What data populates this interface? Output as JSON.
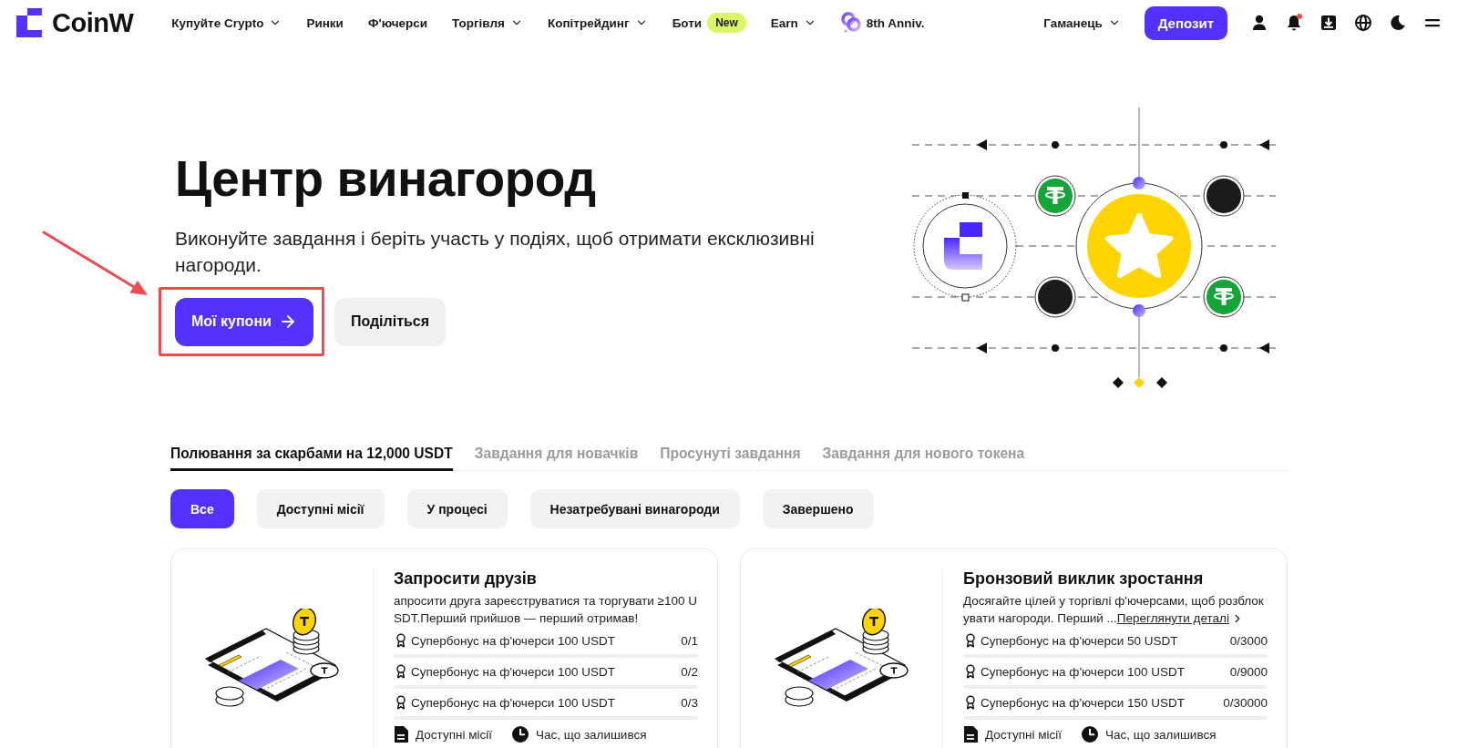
{
  "nav": {
    "logo": "CoinW",
    "items": [
      {
        "label": "Купуйте Crypto",
        "kind": "dropdown"
      },
      {
        "label": "Ринки",
        "kind": "link"
      },
      {
        "label": "Ф'ючерси",
        "kind": "link"
      },
      {
        "label": "Торгівля",
        "kind": "dropdown"
      },
      {
        "label": "Копітрейдинг",
        "kind": "dropdown"
      },
      {
        "label": "Боти",
        "kind": "badge",
        "badge": "New"
      },
      {
        "label": "Earn",
        "kind": "dropdown"
      },
      {
        "label": "8th Anniv.",
        "kind": "event"
      }
    ],
    "wallet": {
      "label": "Гаманець",
      "kind": "dropdown"
    },
    "deposit": "Депозит",
    "unread_notifications": true
  },
  "hero": {
    "title": "Центр винагород",
    "subtitle": "Виконуйте завдання і беріть участь у подіях, щоб отримати ексклюзивні нагороди.",
    "buttons": [
      {
        "label": "Мої купони",
        "kind": "primary",
        "highlighted": true
      },
      {
        "label": "Поділіться",
        "kind": "secondary",
        "highlighted": false
      }
    ]
  },
  "tabs": [
    {
      "label": "Полювання за скарбами на 12,000 USDT",
      "selected": true
    },
    {
      "label": "Завдання для новачків",
      "selected": false
    },
    {
      "label": "Просунуті завдання",
      "selected": false
    },
    {
      "label": "Завдання для нового токена",
      "selected": false
    }
  ],
  "filters": [
    {
      "label": "Все",
      "selected": true
    },
    {
      "label": "Доступні місії",
      "selected": false
    },
    {
      "label": "У процесі",
      "selected": false
    },
    {
      "label": "Незатребувані винагороди",
      "selected": false
    },
    {
      "label": "Завершено",
      "selected": false
    }
  ],
  "tasks": [
    {
      "title": "Запросити друзів",
      "description": "апросити друга зареєструватися та торгувати ≥100 USDT.Перший прийшов — перший отримав!",
      "rewards": [
        {
          "label": "Супербонус на ф'ючерси 100 USDT",
          "count": "0/1",
          "level": 0
        },
        {
          "label": "Супербонус на ф'ючерси 100 USDT",
          "count": "0/2",
          "level": 0
        },
        {
          "label": "Супербонус на ф'ючерси 100 USDT",
          "count": "0/3",
          "level": 0
        }
      ],
      "footer": [
        {
          "kind": "missions",
          "label": "Доступні місії"
        },
        {
          "kind": "time",
          "label": "Час, що залишився"
        }
      ]
    },
    {
      "title": "Бронзовий виклик зростання",
      "description": "Досягайте цілей у торгівлі ф'ючерсами, щоб розблокувати нагороди. Перший ...",
      "link": "Переглянути деталі",
      "rewards": [
        {
          "label": "Супербонус на ф'ючерси 50 USDT",
          "count": "0/3000",
          "level": 0
        },
        {
          "label": "Супербонус на ф'ючерси 100 USDT",
          "count": "0/9000",
          "level": 0
        },
        {
          "label": "Супербонус на ф'ючерси 150 USDT",
          "count": "0/30000",
          "level": 0
        }
      ],
      "footer": [
        {
          "kind": "missions",
          "label": "Доступні місії"
        },
        {
          "kind": "time",
          "label": "Час, що залишився"
        }
      ]
    }
  ]
}
